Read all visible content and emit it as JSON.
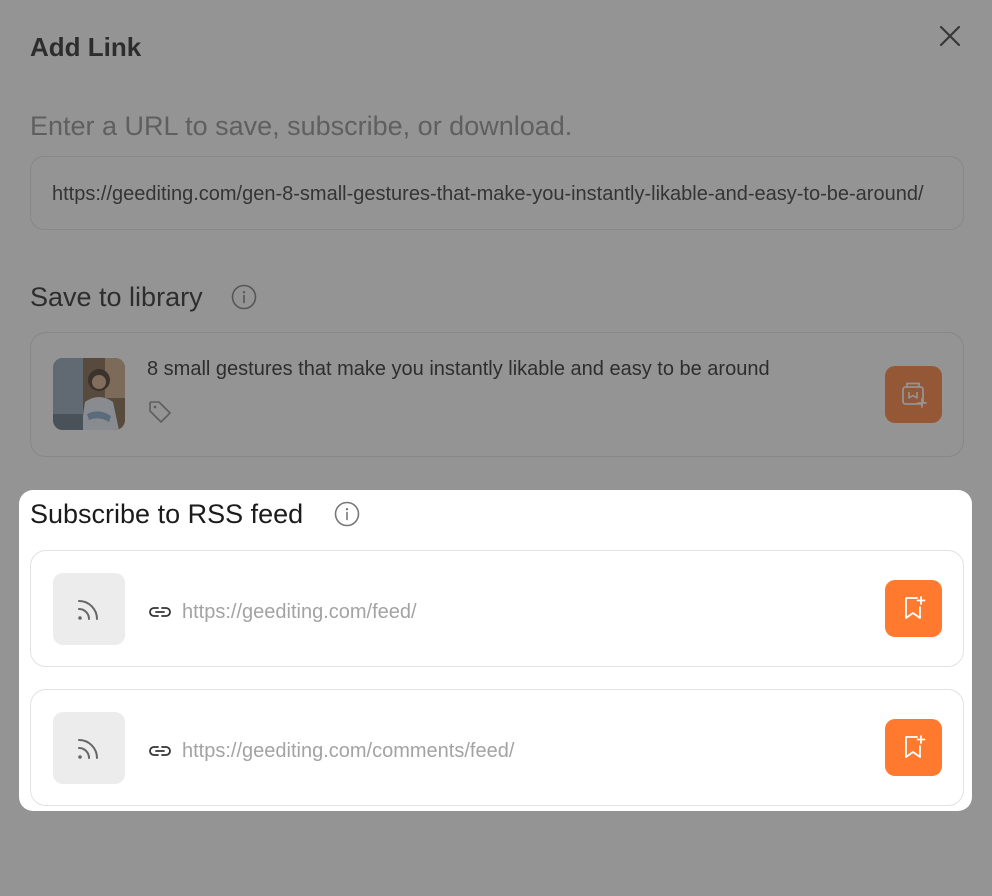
{
  "dialog": {
    "title": "Add Link",
    "hint": "Enter a URL to save, subscribe, or download.",
    "url_value": "https://geediting.com/gen-8-small-gestures-that-make-you-instantly-likable-and-easy-to-be-around/"
  },
  "save": {
    "section_title": "Save to library",
    "article_title": "8 small gestures that make you instantly likable and easy to be around"
  },
  "rss": {
    "section_title": "Subscribe to RSS feed",
    "feeds": [
      {
        "url": "https://geediting.com/feed/"
      },
      {
        "url": "https://geediting.com/comments/feed/"
      }
    ]
  },
  "colors": {
    "accent": "#ff7a2f",
    "overlay": "rgba(60,60,60,0.55)"
  }
}
